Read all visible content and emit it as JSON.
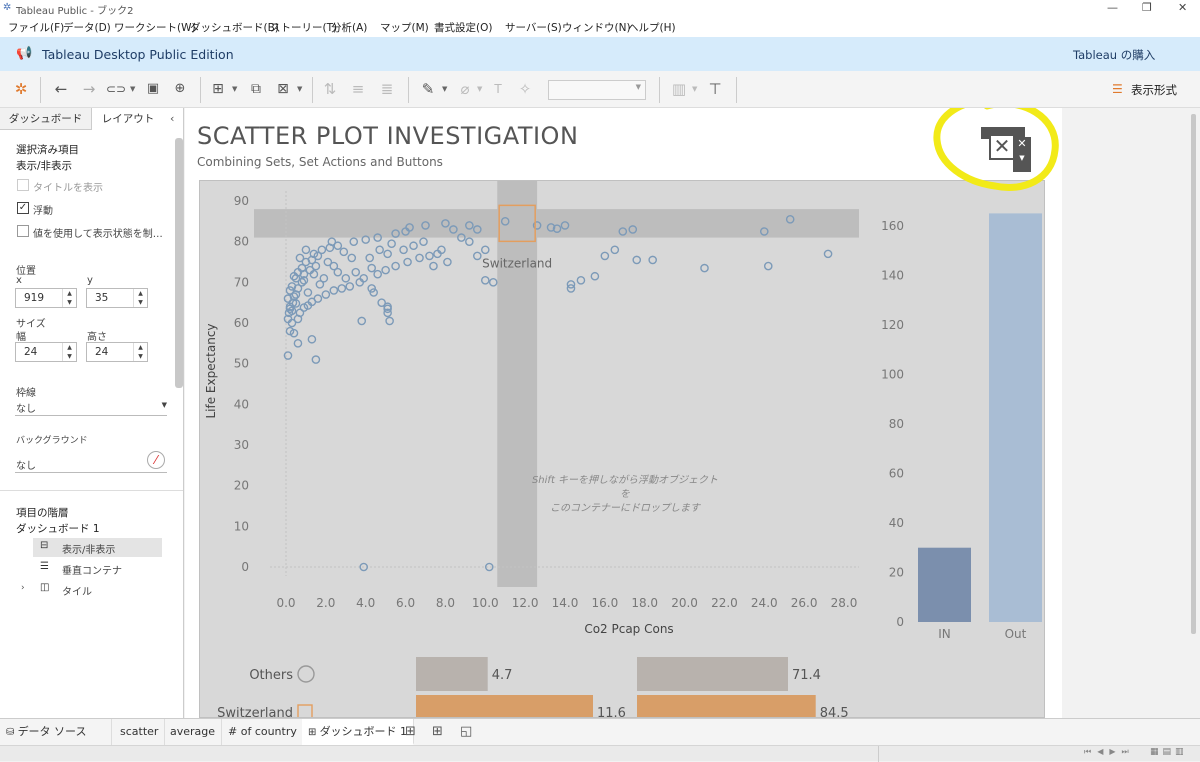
{
  "window": {
    "title": "Tableau Public - ブック2",
    "minimize": "—",
    "maximize": "❐",
    "close": "✕"
  },
  "menu": [
    "ファイル(F)",
    "データ(D)",
    "ワークシート(W)",
    "ダッシュボード(B)",
    "ストーリー(T)",
    "分析(A)",
    "マップ(M)",
    "書式設定(O)",
    "サーバー(S)",
    "ウィンドウ(N)",
    "ヘルプ(H)"
  ],
  "banner": {
    "title": "Tableau Desktop Public Edition",
    "buy": "Tableau の購入"
  },
  "toolbar": {
    "show_me": "表示形式"
  },
  "left_panel": {
    "tabs": [
      "ダッシュボード",
      "レイアウト"
    ],
    "selected_section": "選択済み項目",
    "show_hide": "表示/非表示",
    "show_title": "タイトルを表示",
    "floating": "浮動",
    "conditional": "値を使用して表示状態を制…",
    "position": "位置",
    "x_label": "x",
    "y_label": "y",
    "x_value": "919",
    "y_value": "35",
    "size": "サイズ",
    "width_label": "幅",
    "height_label": "高さ",
    "width_value": "24",
    "height_value": "24",
    "border": "枠線",
    "border_value": "なし",
    "background": "バックグラウンド",
    "background_value": "なし",
    "hierarchy": "項目の階層",
    "dashboard_item": "ダッシュボード 1",
    "tree": [
      "表示/非表示",
      "垂直コンテナ",
      "タイル"
    ]
  },
  "dashboard": {
    "title": "SCATTER PLOT INVESTIGATION",
    "subtitle": "Combining Sets, Set Actions and Buttons",
    "drop_hint": [
      "Shift キーを押しながら浮動オブジェクトを",
      "このコンテナーにドロップします"
    ],
    "highlight_label": "Switzerland"
  },
  "chart_data": [
    {
      "type": "scatter",
      "xlabel": "Co2 Pcap Cons",
      "ylabel": "Life Expectancy",
      "xlim": [
        -1,
        29.5
      ],
      "ylim": [
        -2,
        92
      ],
      "xticks": [
        "0.0",
        "2.0",
        "4.0",
        "6.0",
        "8.0",
        "10.0",
        "12.0",
        "14.0",
        "16.0",
        "18.0",
        "20.0",
        "22.0",
        "24.0",
        "26.0",
        "28.0"
      ],
      "yticks": [
        "0",
        "10",
        "20",
        "30",
        "40",
        "50",
        "60",
        "70",
        "80",
        "90"
      ],
      "highlight": {
        "name": "Switzerland",
        "x": 11.6,
        "y": 84.5
      },
      "points": [
        [
          0.1,
          52
        ],
        [
          0.2,
          58
        ],
        [
          0.1,
          61
        ],
        [
          0.15,
          62.5
        ],
        [
          0.3,
          63
        ],
        [
          0.2,
          64
        ],
        [
          0.35,
          65
        ],
        [
          0.1,
          66
        ],
        [
          0.4,
          66.5
        ],
        [
          0.5,
          67
        ],
        [
          0.2,
          68
        ],
        [
          0.6,
          68.5
        ],
        [
          0.3,
          69
        ],
        [
          0.8,
          70
        ],
        [
          0.5,
          71
        ],
        [
          0.4,
          71.5
        ],
        [
          0.9,
          72
        ],
        [
          0.6,
          72.5
        ],
        [
          1.2,
          73
        ],
        [
          0.8,
          73.5
        ],
        [
          1.5,
          74
        ],
        [
          1,
          75
        ],
        [
          0.7,
          76
        ],
        [
          1.4,
          77
        ],
        [
          1.8,
          78
        ],
        [
          2.2,
          78.5
        ],
        [
          2.6,
          79
        ],
        [
          3.4,
          80
        ],
        [
          2.3,
          80
        ],
        [
          4,
          80.5
        ],
        [
          4.6,
          81
        ],
        [
          5.5,
          82
        ],
        [
          6,
          82.5
        ],
        [
          6.2,
          83.5
        ],
        [
          7,
          84
        ],
        [
          8,
          84.5
        ],
        [
          8.4,
          83
        ],
        [
          9.2,
          84
        ],
        [
          9.6,
          83
        ],
        [
          11,
          85
        ],
        [
          12.6,
          84
        ],
        [
          13.3,
          83.5
        ],
        [
          14,
          84
        ],
        [
          13.6,
          83.2
        ],
        [
          16.9,
          82.5
        ],
        [
          17.4,
          83
        ],
        [
          24,
          82.5
        ],
        [
          25.3,
          85.5
        ],
        [
          0.3,
          60
        ],
        [
          0.6,
          61
        ],
        [
          0.7,
          62.5
        ],
        [
          0.2,
          63.5
        ],
        [
          0.9,
          63.8
        ],
        [
          1.1,
          64.3
        ],
        [
          0.5,
          64.8
        ],
        [
          1.3,
          65.2
        ],
        [
          1.6,
          66
        ],
        [
          2,
          67
        ],
        [
          2.4,
          68
        ],
        [
          2.8,
          68.5
        ],
        [
          3.2,
          69
        ],
        [
          3.7,
          70
        ],
        [
          3.9,
          71
        ],
        [
          4.6,
          72
        ],
        [
          5,
          73
        ],
        [
          5.5,
          74
        ],
        [
          6.1,
          75
        ],
        [
          6.7,
          76
        ],
        [
          7.2,
          76.5
        ],
        [
          7.6,
          77
        ],
        [
          4.3,
          73.5
        ],
        [
          3,
          71
        ],
        [
          2.6,
          72.5
        ],
        [
          1.9,
          71
        ],
        [
          1.7,
          69.5
        ],
        [
          1.1,
          67.5
        ],
        [
          3.5,
          72.5
        ],
        [
          4.2,
          76
        ],
        [
          5.1,
          77
        ],
        [
          5.9,
          78
        ],
        [
          6.4,
          79
        ],
        [
          6.9,
          80
        ],
        [
          8.8,
          81
        ],
        [
          9.2,
          80
        ],
        [
          10,
          78
        ],
        [
          9.6,
          76.5
        ],
        [
          8.1,
          75
        ],
        [
          7.4,
          74
        ],
        [
          7.8,
          78
        ],
        [
          3.3,
          76
        ],
        [
          2.9,
          77.5
        ],
        [
          4.7,
          78
        ],
        [
          5.3,
          79.5
        ],
        [
          2.1,
          75
        ],
        [
          2.4,
          74
        ],
        [
          1.4,
          72
        ],
        [
          0.9,
          70.5
        ],
        [
          1.3,
          75.5
        ],
        [
          1,
          78
        ],
        [
          1.6,
          76.5
        ],
        [
          10,
          70.5
        ],
        [
          10.4,
          70
        ],
        [
          14.3,
          69.5
        ],
        [
          14.3,
          68.5
        ],
        [
          14.8,
          70.5
        ],
        [
          15.5,
          71.5
        ],
        [
          16,
          76.5
        ],
        [
          16.5,
          78
        ],
        [
          17.6,
          75.5
        ],
        [
          18.4,
          75.5
        ],
        [
          21,
          73.5
        ],
        [
          24.2,
          74
        ],
        [
          27.2,
          77
        ],
        [
          3.8,
          60.5
        ],
        [
          5.1,
          62.5
        ],
        [
          5.2,
          60.5
        ],
        [
          5.1,
          64
        ],
        [
          4.8,
          65
        ],
        [
          5.1,
          63.5
        ],
        [
          4.4,
          67.5
        ],
        [
          4.3,
          68.5
        ],
        [
          1.5,
          51
        ],
        [
          0.6,
          55
        ],
        [
          1.3,
          56
        ],
        [
          0.4,
          57.5
        ],
        [
          3.9,
          0
        ],
        [
          10.2,
          0
        ]
      ]
    },
    {
      "type": "bar",
      "categories": [
        "IN",
        "Out"
      ],
      "values": [
        30,
        165
      ],
      "ylim": [
        0,
        170
      ],
      "yticks": [
        "0",
        "20",
        "40",
        "60",
        "80",
        "100",
        "120",
        "140",
        "160"
      ]
    },
    {
      "type": "bar",
      "categories": [
        "Others",
        "Switzerland"
      ],
      "series": [
        {
          "values": [
            4.7,
            11.6
          ],
          "labels": [
            "4.7",
            "11.6"
          ]
        },
        {
          "values": [
            71.4,
            84.5
          ],
          "labels": [
            "71.4",
            "84.5"
          ]
        }
      ]
    }
  ],
  "bottom_tabs": [
    "データ ソース",
    "scatter",
    "average",
    "# of country",
    "ダッシュボード 1"
  ],
  "colors": {
    "point": "#7c9ab8",
    "highlight": "#e39e5f",
    "in_bar": "#7b8fad",
    "out_bar": "#a9bdd4",
    "others_bar": "#b8b2ad",
    "switz_bar": "#d89e68",
    "marker_circle": "#f2ea18",
    "banner": "#d6ebfb"
  }
}
